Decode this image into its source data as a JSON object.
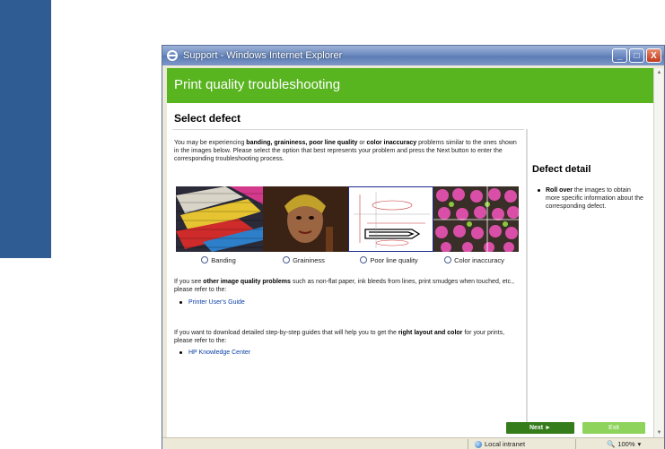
{
  "window": {
    "title": "Support - Windows Internet Explorer",
    "buttons": {
      "minimize": "_",
      "maximize": "□",
      "close": "X"
    }
  },
  "page": {
    "banner": "Print quality troubleshooting",
    "section_title": "Select defect",
    "intro_part1": "You may be experiencing ",
    "intro_bold1": "banding, graininess, poor line quality",
    "intro_mid": " or ",
    "intro_bold2": "color inaccuracy",
    "intro_part2": " problems similar to the ones shown in the images below. Please select the option that best represents your problem and press the Next button to enter the corresponding troubleshooting process.",
    "options": [
      "Banding",
      "Graininess",
      "Poor line quality",
      "Color inaccuracy"
    ],
    "para2_part1": "If you see ",
    "para2_bold": "other image quality problems",
    "para2_part2": " such as non-flat paper, ink bleeds from lines, print smudges when touched, etc., please refer to the:",
    "link1": "Printer User's Guide",
    "para3_part1": "If you want to download detailed step-by-step guides that will help you to get the ",
    "para3_bold": "right layout and color",
    "para3_part2": " for your prints, please refer to the:",
    "link2": "HP Knowledge Center",
    "next_label": "Next ►",
    "exit_label": "Exit"
  },
  "sidebar": {
    "title": "Defect detail",
    "bold": "Roll over",
    "text": " the images to obtain more specific information about the corresponding defect."
  },
  "statusbar": {
    "zone": "Local intranet",
    "zoom": "100%",
    "zoom_arrow": "▾"
  },
  "colors": {
    "banner": "#58b41f",
    "next_button": "#357c1a",
    "exit_button": "#8ed35c",
    "desktop_blue": "#2f5c93"
  }
}
